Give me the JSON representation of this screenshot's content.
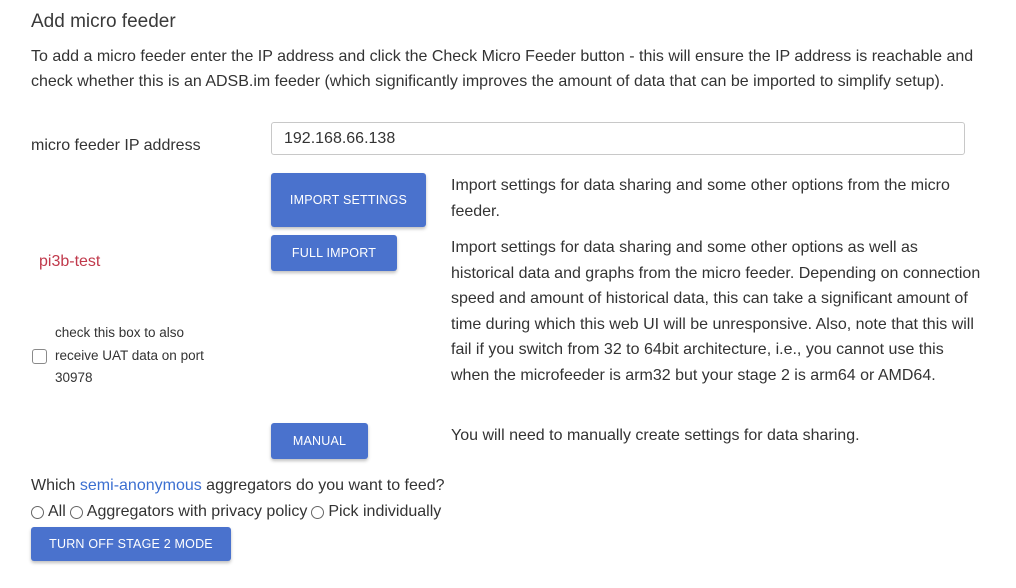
{
  "section": {
    "title": "Add micro feeder",
    "intro": "To add a micro feeder enter the IP address and click the Check Micro Feeder button - this will ensure the IP address is reachable and check whether this is an ADSB.im feeder (which significantly improves the amount of data that can be imported to simplify setup)."
  },
  "ip_field": {
    "label": "micro feeder IP address",
    "value": "192.168.66.138"
  },
  "import_settings": {
    "button": "IMPORT SETTINGS",
    "description": "Import settings for data sharing and some other options from the micro feeder."
  },
  "full_import": {
    "button": "FULL IMPORT",
    "description": "Import settings for data sharing and some other options as well as historical data and graphs from the micro feeder. Depending on connection speed and amount of historical data, this can take a significant amount of time during which this web UI will be unresponsive. Also, note that this will fail if you switch from 32 to 64bit architecture, i.e., you cannot use this when the microfeeder is arm32 but your stage 2 is arm64 or AMD64."
  },
  "hostname": "pi3b-test",
  "uat": {
    "label": "check this box to also receive UAT data on port 30978",
    "checked": false
  },
  "manual": {
    "button": "MANUAL",
    "description": "You will need to manually create settings for data sharing."
  },
  "aggregators": {
    "question_prefix": "Which ",
    "question_link": "semi-anonymous",
    "question_suffix": " aggregators do you want to feed?",
    "options": [
      "All",
      "Aggregators with privacy policy",
      "Pick individually"
    ]
  },
  "stage2_button": "TURN OFF STAGE 2 MODE",
  "colors": {
    "button": "#4a72cd",
    "hostname": "#c0394b",
    "link": "#3b6fd1"
  }
}
